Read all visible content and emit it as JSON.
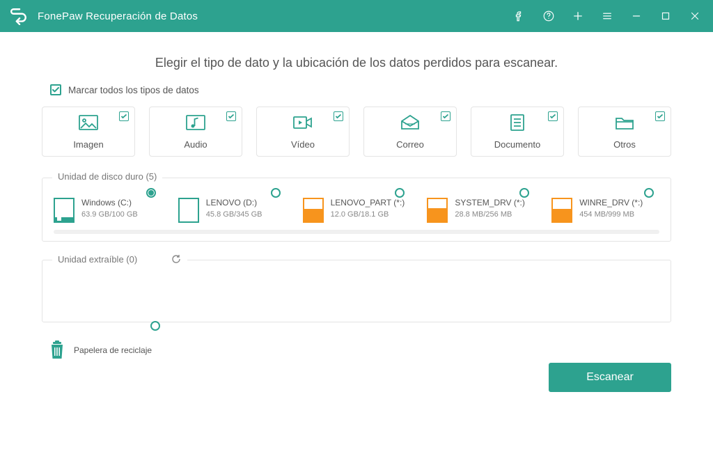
{
  "app_title": "FonePaw Recuperación de Datos",
  "heading": "Elegir el tipo de dato y la ubicación de los datos perdidos para escanear.",
  "select_all_label": "Marcar todos los tipos de datos",
  "categories": [
    {
      "id": "imagen",
      "label": "Imagen",
      "checked": true
    },
    {
      "id": "audio",
      "label": "Audio",
      "checked": true
    },
    {
      "id": "video",
      "label": "Vídeo",
      "checked": true
    },
    {
      "id": "correo",
      "label": "Correo",
      "checked": true
    },
    {
      "id": "documento",
      "label": "Documento",
      "checked": true
    },
    {
      "id": "otros",
      "label": "Otros",
      "checked": true
    }
  ],
  "hdd_section_label": "Unidad de disco duro (5)",
  "drives": [
    {
      "name": "Windows (C:)",
      "size": "63.9 GB/100 GB",
      "fill_pct": 18,
      "color": "teal",
      "selected": true,
      "system": true
    },
    {
      "name": "LENOVO (D:)",
      "size": "45.8 GB/345 GB",
      "fill_pct": 0,
      "color": "teal",
      "selected": false,
      "system": false
    },
    {
      "name": "LENOVO_PART (*:)",
      "size": "12.0 GB/18.1 GB",
      "fill_pct": 55,
      "color": "orange",
      "selected": false,
      "system": false
    },
    {
      "name": "SYSTEM_DRV (*:)",
      "size": "28.8 MB/256 MB",
      "fill_pct": 60,
      "color": "orange",
      "selected": false,
      "system": false
    },
    {
      "name": "WINRE_DRV (*:)",
      "size": "454 MB/999 MB",
      "fill_pct": 55,
      "color": "orange",
      "selected": false,
      "system": false
    }
  ],
  "removable_section_label": "Unidad extraíble (0)",
  "recycle_label": "Papelera de reciclaje",
  "scan_button": "Escanear",
  "colors": {
    "accent": "#2da28f",
    "orange": "#f7941d"
  }
}
